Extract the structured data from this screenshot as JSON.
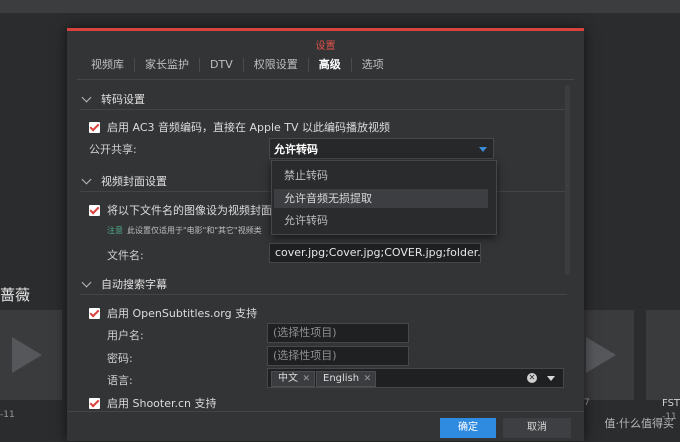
{
  "background": {
    "left_title": "蔷薇",
    "left_date": "-11",
    "right_date_1": "7",
    "right_date_2": "-11",
    "right_label": "FST",
    "watermark": "值·什么值得买"
  },
  "dialog": {
    "title": "设置",
    "tabs": [
      {
        "label": "视频库",
        "active": false
      },
      {
        "label": "家长监护",
        "active": false
      },
      {
        "label": "DTV",
        "active": false
      },
      {
        "label": "权限设置",
        "active": false
      },
      {
        "label": "高级",
        "active": true
      },
      {
        "label": "选项",
        "active": false
      }
    ],
    "transcode": {
      "header": "转码设置",
      "ac3_label": "启用 AC3 音频编码，直接在 Apple TV 以此编码播放视频",
      "share_label": "公开共享:",
      "share_value": "允许转码",
      "options": [
        "禁止转码",
        "允许音频无损提取",
        "允许转码"
      ]
    },
    "cover": {
      "header": "视频封面设置",
      "check_label": "将以下文件名的图像设为视频封面。",
      "note_highlight": "注意",
      "note_text": "此设置仅适用于\"电影\"和\"其它\"视频类",
      "filename_label": "文件名:",
      "filename_value": "cover.jpg;Cover.jpg;COVER.jpg;folder.jpg;Folde"
    },
    "subtitles": {
      "header": "自动搜索字幕",
      "opensub_label": "启用 OpenSubtitles.org 支持",
      "username_label": "用户名:",
      "username_placeholder": "(选择性项目)",
      "password_label": "密码:",
      "password_placeholder": "(选择性项目)",
      "language_label": "语言:",
      "languages": [
        "中文",
        "English"
      ],
      "shooter_label": "启用 Shooter.cn 支持"
    },
    "footer": {
      "ok": "确定",
      "cancel": "取消"
    }
  }
}
